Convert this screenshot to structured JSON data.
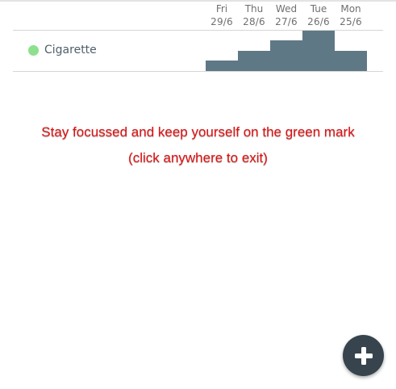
{
  "header": {
    "days": [
      {
        "weekday": "Fri",
        "date": "29/6"
      },
      {
        "weekday": "Thu",
        "date": "28/6"
      },
      {
        "weekday": "Wed",
        "date": "27/6"
      },
      {
        "weekday": "Tue",
        "date": "26/6"
      },
      {
        "weekday": "Mon",
        "date": "25/6"
      }
    ]
  },
  "habits": [
    {
      "name": "Cigarette",
      "dot_color": "#8ee08e",
      "bar_color": "#5f7886",
      "levels": [
        0.26,
        0.5,
        0.76,
        1.0,
        0.5
      ]
    }
  ],
  "overlay": {
    "line1": "Stay focussed and keep yourself on the green mark",
    "line2": "(click anywhere to exit)",
    "color": "#e11010"
  },
  "fab": {
    "icon": "plus-icon"
  }
}
